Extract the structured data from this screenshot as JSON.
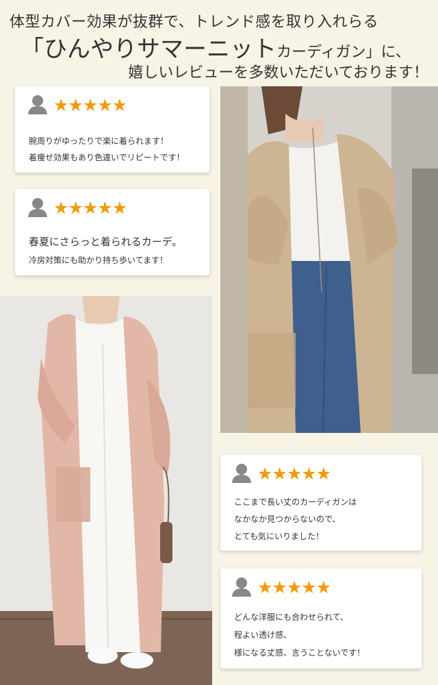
{
  "header": {
    "line1": "体型カバー効果が抜群で、トレンド感を取り入れらる",
    "line2_main": "「ひんやりサマーニット",
    "line2_small": "カーディガン」に、",
    "line3": "嬉しいレビューを多数いただいております！"
  },
  "reviews": [
    {
      "stars": "★★★★★",
      "lines": [
        "腕周りがゆったりで楽に着られます！",
        "着痩せ効果もあり色違いでリピートです！"
      ]
    },
    {
      "stars": "★★★★★",
      "lines": [
        "春夏にさらっと着られるカーデ。",
        "冷房対策にも助かり持ち歩いてます！"
      ]
    },
    {
      "stars": "★★★★★",
      "lines": [
        "ここまで長い丈のカーディガンは",
        "なかなか見つからないので、",
        "とても気にいりました！"
      ]
    },
    {
      "stars": "★★★★★",
      "lines": [
        "どんな洋服にも合わせられて、",
        "程よい透け感、",
        "様になる丈感、言うことないです！"
      ]
    }
  ],
  "colors": {
    "star": "#f29a06",
    "avatar": "#888888",
    "background": "#f7f4e6"
  },
  "icons": {
    "avatar": "user-avatar-icon"
  }
}
